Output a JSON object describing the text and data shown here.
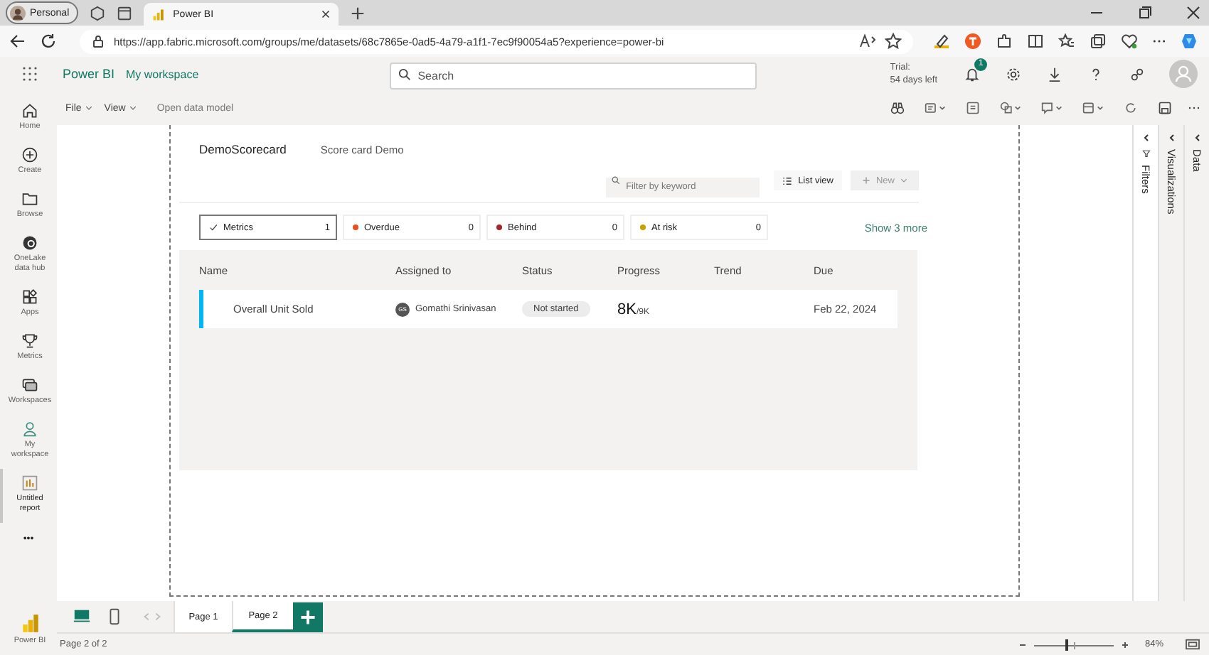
{
  "browser": {
    "profile": "Personal",
    "tabs": [
      {
        "title": "Power BI",
        "selected": true
      }
    ],
    "url": "https://app.fabric.microsoft.com/groups/me/datasets/68c7865e-0ad5-4a79-a1f1-7ec9f90054a5?experience=power-bi"
  },
  "app_header": {
    "product": "Power BI",
    "workspace": "My workspace",
    "search": {
      "placeholder": "Search"
    },
    "trial": "Trial:",
    "trial_days": "54 days left",
    "notification_count": "1"
  },
  "nav": [
    {
      "label": "Home",
      "selected": false
    },
    {
      "label": "Create",
      "selected": false
    },
    {
      "label": "Browse",
      "selected": false
    },
    {
      "label": "OneLake data hub",
      "selected": false
    },
    {
      "label": "Apps",
      "selected": false
    },
    {
      "label": "Metrics",
      "selected": false
    },
    {
      "label": "Workspaces",
      "selected": false
    },
    {
      "label": "My workspace",
      "selected": false
    },
    {
      "label": "Untitled report",
      "selected": true
    }
  ],
  "nav_more": "•••",
  "nav_footer": "Power BI",
  "toolbar": {
    "menus": [
      "File",
      "View"
    ],
    "action": "Open data model"
  },
  "scorecard": {
    "name": "DemoScorecard",
    "subtitle": "Score card Demo",
    "filter": {
      "placeholder": "Filter by keyword"
    },
    "list_view": "List view",
    "new": "New",
    "chips": [
      {
        "label": "Metrics",
        "count": "1",
        "selected": true
      },
      {
        "label": "Overdue",
        "count": "0",
        "selected": false,
        "color": "#e8501a"
      },
      {
        "label": "Behind",
        "count": "0",
        "selected": false,
        "color": "#a4262c"
      },
      {
        "label": "At risk",
        "count": "0",
        "selected": false,
        "color": "#c8a000"
      }
    ],
    "show_more": "Show 3 more",
    "columns": [
      "Name",
      "Assigned to",
      "Status",
      "Progress",
      "Trend",
      "Due"
    ],
    "rows": [
      {
        "name": "Overall Unit Sold",
        "initials": "GS",
        "assignee": "Gomathi Srinivasan",
        "status": "Not started",
        "value": "8K",
        "target": "/9K",
        "due": "Feb 22, 2024"
      }
    ]
  },
  "panes": [
    "Filters",
    "Visualizations",
    "Data"
  ],
  "pages": [
    {
      "label": "Page 1",
      "selected": false
    },
    {
      "label": "Page 2",
      "selected": true
    }
  ],
  "status_bar": {
    "page": "Page 2 of 2",
    "zoom": "84%",
    "zoom_slider": {
      "level": 0.4
    }
  }
}
